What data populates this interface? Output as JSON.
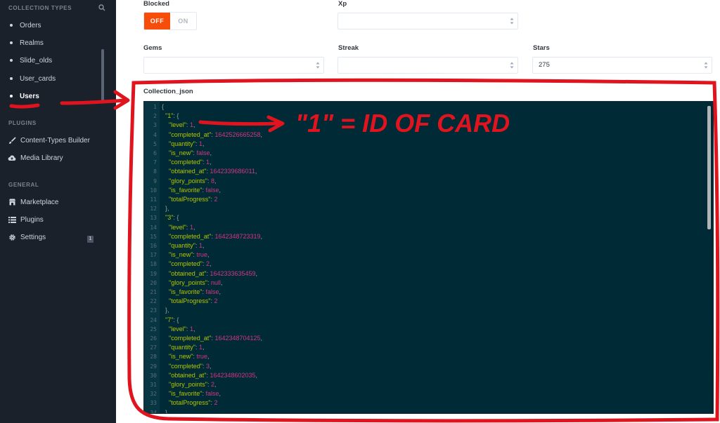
{
  "sidebar": {
    "collection_types_title": "COLLECTION TYPES",
    "items": [
      {
        "label": "Orders"
      },
      {
        "label": "Realms"
      },
      {
        "label": "Slide_olds"
      },
      {
        "label": "User_cards"
      },
      {
        "label": "Users",
        "active": true
      }
    ],
    "plugins_title": "PLUGINS",
    "plugins": [
      {
        "label": "Content-Types Builder",
        "icon": "paintbrush-icon"
      },
      {
        "label": "Media Library",
        "icon": "cloud-upload-icon"
      }
    ],
    "general_title": "GENERAL",
    "general": [
      {
        "label": "Marketplace",
        "icon": "shop-icon"
      },
      {
        "label": "Plugins",
        "icon": "list-icon"
      },
      {
        "label": "Settings",
        "icon": "gear-icon",
        "badge": "1"
      }
    ]
  },
  "form": {
    "blocked": {
      "label": "Blocked",
      "off_label": "OFF",
      "on_label": "ON",
      "value": "OFF"
    },
    "xp": {
      "label": "Xp",
      "value": ""
    },
    "gems": {
      "label": "Gems",
      "value": ""
    },
    "streak": {
      "label": "Streak",
      "value": ""
    },
    "stars": {
      "label": "Stars",
      "value": "275"
    },
    "collection_json": {
      "label": "Collection_json"
    }
  },
  "editor": {
    "lines": [
      [
        [
          "p",
          "{"
        ]
      ],
      [
        [
          "p",
          "  "
        ],
        [
          "k",
          "\"1\""
        ],
        [
          "p",
          ": {"
        ]
      ],
      [
        [
          "p",
          "    "
        ],
        [
          "k",
          "\"level\""
        ],
        [
          "p",
          ": "
        ],
        [
          "n",
          "1"
        ],
        [
          "p",
          ","
        ]
      ],
      [
        [
          "p",
          "    "
        ],
        [
          "k",
          "\"completed_at\""
        ],
        [
          "p",
          ": "
        ],
        [
          "n",
          "1642526665258"
        ],
        [
          "p",
          ","
        ]
      ],
      [
        [
          "p",
          "    "
        ],
        [
          "k",
          "\"quantity\""
        ],
        [
          "p",
          ": "
        ],
        [
          "n",
          "1"
        ],
        [
          "p",
          ","
        ]
      ],
      [
        [
          "p",
          "    "
        ],
        [
          "k",
          "\"is_new\""
        ],
        [
          "p",
          ": "
        ],
        [
          "n",
          "false"
        ],
        [
          "p",
          ","
        ]
      ],
      [
        [
          "p",
          "    "
        ],
        [
          "k",
          "\"completed\""
        ],
        [
          "p",
          ": "
        ],
        [
          "n",
          "1"
        ],
        [
          "p",
          ","
        ]
      ],
      [
        [
          "p",
          "    "
        ],
        [
          "k",
          "\"obtained_at\""
        ],
        [
          "p",
          ": "
        ],
        [
          "n",
          "1642339686011"
        ],
        [
          "p",
          ","
        ]
      ],
      [
        [
          "p",
          "    "
        ],
        [
          "k",
          "\"glory_points\""
        ],
        [
          "p",
          ": "
        ],
        [
          "n",
          "8"
        ],
        [
          "p",
          ","
        ]
      ],
      [
        [
          "p",
          "    "
        ],
        [
          "k",
          "\"is_favorite\""
        ],
        [
          "p",
          ": "
        ],
        [
          "n",
          "false"
        ],
        [
          "p",
          ","
        ]
      ],
      [
        [
          "p",
          "    "
        ],
        [
          "k",
          "\"totalProgress\""
        ],
        [
          "p",
          ": "
        ],
        [
          "n",
          "2"
        ]
      ],
      [
        [
          "p",
          "  },"
        ]
      ],
      [
        [
          "p",
          "  "
        ],
        [
          "k",
          "\"3\""
        ],
        [
          "p",
          ": {"
        ]
      ],
      [
        [
          "p",
          "    "
        ],
        [
          "k",
          "\"level\""
        ],
        [
          "p",
          ": "
        ],
        [
          "n",
          "1"
        ],
        [
          "p",
          ","
        ]
      ],
      [
        [
          "p",
          "    "
        ],
        [
          "k",
          "\"completed_at\""
        ],
        [
          "p",
          ": "
        ],
        [
          "n",
          "1642348723319"
        ],
        [
          "p",
          ","
        ]
      ],
      [
        [
          "p",
          "    "
        ],
        [
          "k",
          "\"quantity\""
        ],
        [
          "p",
          ": "
        ],
        [
          "n",
          "1"
        ],
        [
          "p",
          ","
        ]
      ],
      [
        [
          "p",
          "    "
        ],
        [
          "k",
          "\"is_new\""
        ],
        [
          "p",
          ": "
        ],
        [
          "n",
          "true"
        ],
        [
          "p",
          ","
        ]
      ],
      [
        [
          "p",
          "    "
        ],
        [
          "k",
          "\"completed\""
        ],
        [
          "p",
          ": "
        ],
        [
          "n",
          "2"
        ],
        [
          "p",
          ","
        ]
      ],
      [
        [
          "p",
          "    "
        ],
        [
          "k",
          "\"obtained_at\""
        ],
        [
          "p",
          ": "
        ],
        [
          "n",
          "1642333635459"
        ],
        [
          "p",
          ","
        ]
      ],
      [
        [
          "p",
          "    "
        ],
        [
          "k",
          "\"glory_points\""
        ],
        [
          "p",
          ": "
        ],
        [
          "n",
          "null"
        ],
        [
          "p",
          ","
        ]
      ],
      [
        [
          "p",
          "    "
        ],
        [
          "k",
          "\"is_favorite\""
        ],
        [
          "p",
          ": "
        ],
        [
          "n",
          "false"
        ],
        [
          "p",
          ","
        ]
      ],
      [
        [
          "p",
          "    "
        ],
        [
          "k",
          "\"totalProgress\""
        ],
        [
          "p",
          ": "
        ],
        [
          "n",
          "2"
        ]
      ],
      [
        [
          "p",
          "  },"
        ]
      ],
      [
        [
          "p",
          "  "
        ],
        [
          "k",
          "\"7\""
        ],
        [
          "p",
          ": {"
        ]
      ],
      [
        [
          "p",
          "    "
        ],
        [
          "k",
          "\"level\""
        ],
        [
          "p",
          ": "
        ],
        [
          "n",
          "1"
        ],
        [
          "p",
          ","
        ]
      ],
      [
        [
          "p",
          "    "
        ],
        [
          "k",
          "\"completed_at\""
        ],
        [
          "p",
          ": "
        ],
        [
          "n",
          "1642348704125"
        ],
        [
          "p",
          ","
        ]
      ],
      [
        [
          "p",
          "    "
        ],
        [
          "k",
          "\"quantity\""
        ],
        [
          "p",
          ": "
        ],
        [
          "n",
          "1"
        ],
        [
          "p",
          ","
        ]
      ],
      [
        [
          "p",
          "    "
        ],
        [
          "k",
          "\"is_new\""
        ],
        [
          "p",
          ": "
        ],
        [
          "n",
          "true"
        ],
        [
          "p",
          ","
        ]
      ],
      [
        [
          "p",
          "    "
        ],
        [
          "k",
          "\"completed\""
        ],
        [
          "p",
          ": "
        ],
        [
          "n",
          "3"
        ],
        [
          "p",
          ","
        ]
      ],
      [
        [
          "p",
          "    "
        ],
        [
          "k",
          "\"obtained_at\""
        ],
        [
          "p",
          ": "
        ],
        [
          "n",
          "1642348602035"
        ],
        [
          "p",
          ","
        ]
      ],
      [
        [
          "p",
          "    "
        ],
        [
          "k",
          "\"glory_points\""
        ],
        [
          "p",
          ": "
        ],
        [
          "n",
          "2"
        ],
        [
          "p",
          ","
        ]
      ],
      [
        [
          "p",
          "    "
        ],
        [
          "k",
          "\"is_favorite\""
        ],
        [
          "p",
          ": "
        ],
        [
          "n",
          "false"
        ],
        [
          "p",
          ","
        ]
      ],
      [
        [
          "p",
          "    "
        ],
        [
          "k",
          "\"totalProgress\""
        ],
        [
          "p",
          ": "
        ],
        [
          "n",
          "2"
        ]
      ],
      [
        [
          "p",
          "  },"
        ]
      ]
    ]
  },
  "annotation": {
    "text": "\"1\" = ID OF CARD",
    "color": "#e0141e"
  }
}
